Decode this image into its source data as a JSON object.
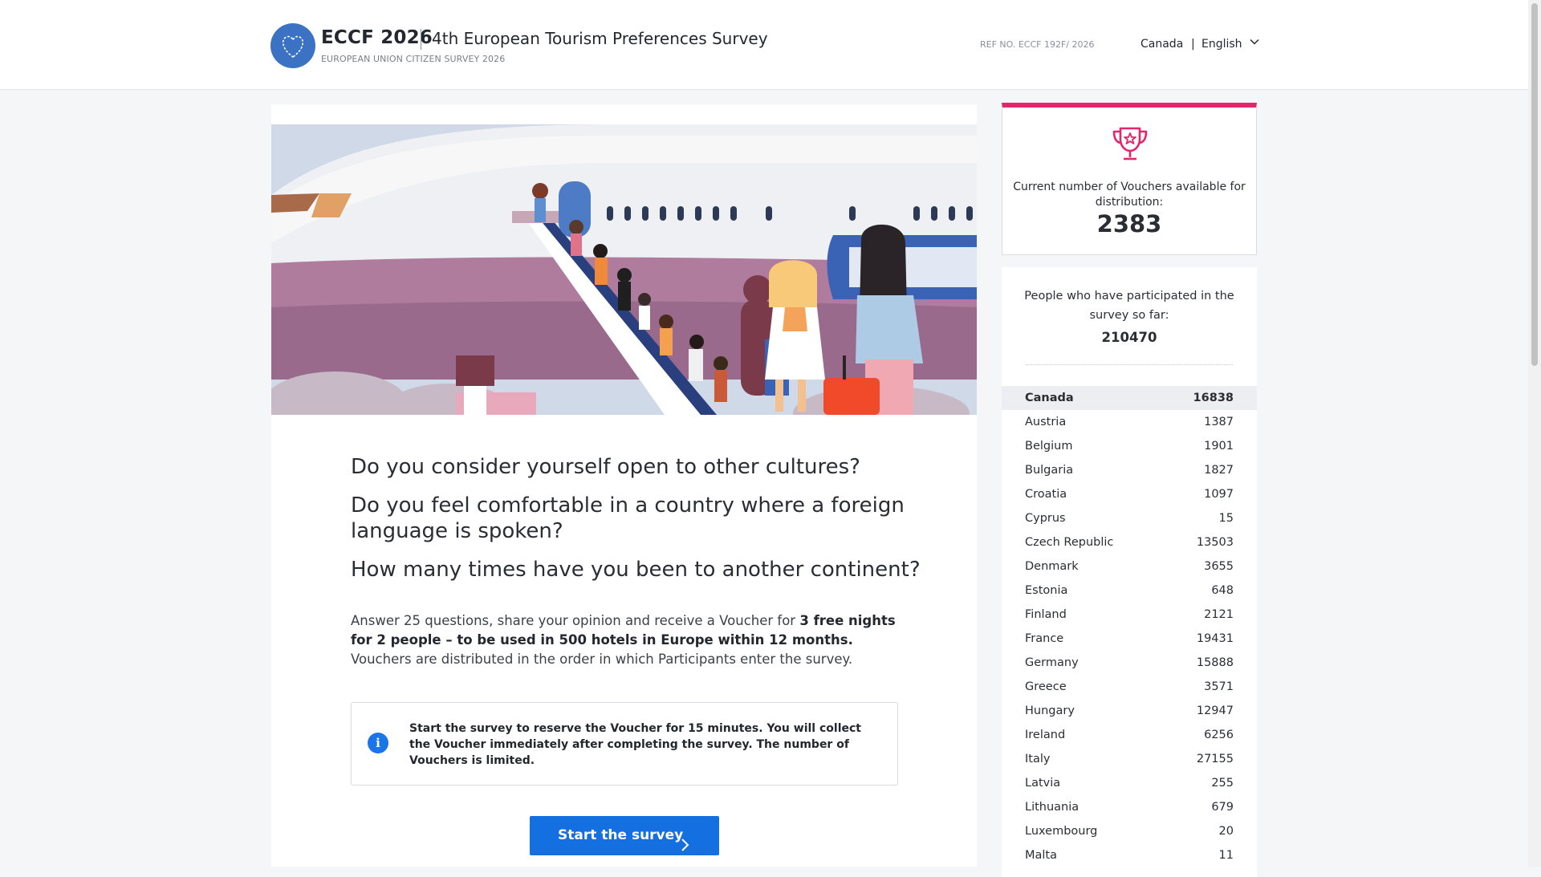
{
  "header": {
    "brand": "ECCF 2026",
    "title": "4th European Tourism Preferences Survey",
    "subtitle": "EUROPEAN UNION CITIZEN SURVEY 2026",
    "ref": "REF NO. ECCF 192F/ 2026",
    "country": "Canada",
    "separator": "|",
    "language": "English",
    "logo_icon": "eu-stars-heart-icon",
    "chevron_icon": "chevron-down-icon"
  },
  "main": {
    "hero_image": "airplane-boarding-illustration",
    "questions": [
      "Do you consider yourself open to other cultures?",
      "Do you feel comfortable in a country where a foreign language is spoken?",
      "How many times have you been to another continent?"
    ],
    "intro": {
      "part1": "Answer 25 questions, share your opinion and receive a Voucher for ",
      "bold": "3 free nights for 2 people – to be used in 500 hotels in Europe within 12 months.",
      "part2": " Vouchers are distributed in the order in which Participants enter the survey."
    },
    "info": {
      "icon": "info-icon",
      "glyph": "i",
      "text": "Start the survey to reserve the Voucher for 15 minutes. You will collect the Voucher immediately after completing the survey. The number of Vouchers is limited."
    },
    "start_button": "Start the survey"
  },
  "sidebar": {
    "voucher": {
      "icon": "trophy-icon",
      "label": "Current number of Vouchers available for distribution:",
      "count": "2383"
    },
    "participants": {
      "label": "People who have participated in the survey so far:",
      "total": "210470",
      "countries": [
        {
          "name": "Canada",
          "count": "16838",
          "active": true
        },
        {
          "name": "Austria",
          "count": "1387"
        },
        {
          "name": "Belgium",
          "count": "1901"
        },
        {
          "name": "Bulgaria",
          "count": "1827"
        },
        {
          "name": "Croatia",
          "count": "1097"
        },
        {
          "name": "Cyprus",
          "count": "15"
        },
        {
          "name": "Czech Republic",
          "count": "13503"
        },
        {
          "name": "Denmark",
          "count": "3655"
        },
        {
          "name": "Estonia",
          "count": "648"
        },
        {
          "name": "Finland",
          "count": "2121"
        },
        {
          "name": "France",
          "count": "19431"
        },
        {
          "name": "Germany",
          "count": "15888"
        },
        {
          "name": "Greece",
          "count": "3571"
        },
        {
          "name": "Hungary",
          "count": "12947"
        },
        {
          "name": "Ireland",
          "count": "6256"
        },
        {
          "name": "Italy",
          "count": "27155"
        },
        {
          "name": "Latvia",
          "count": "255"
        },
        {
          "name": "Lithuania",
          "count": "679"
        },
        {
          "name": "Luxembourg",
          "count": "20"
        },
        {
          "name": "Malta",
          "count": "11"
        }
      ]
    }
  },
  "colors": {
    "accent": "#e3256b",
    "primary": "#1470e0",
    "logo": "#3b72c4"
  }
}
